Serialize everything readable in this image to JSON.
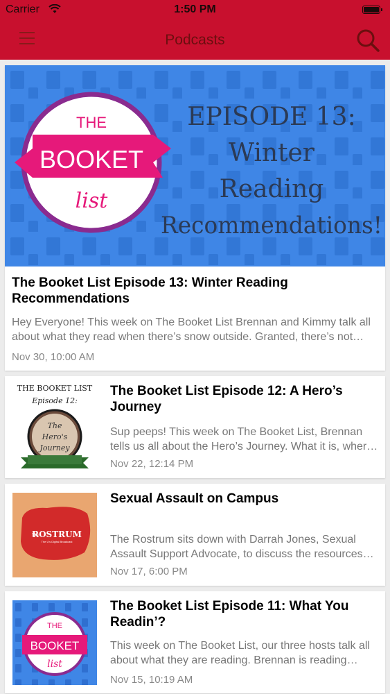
{
  "status_bar": {
    "carrier": "Carrier",
    "time": "1:50 PM"
  },
  "nav": {
    "title": "Podcasts",
    "menu_icon": "hamburger-menu-icon",
    "search_icon": "search-icon"
  },
  "feature": {
    "banner": {
      "brand_top": "THE",
      "brand_main": "BOOKET",
      "brand_bottom": "list",
      "line1": "EPISODE 13:",
      "line2": "Winter",
      "line3": "Reading",
      "line4": "Recommendations!"
    },
    "title": "The Booket List Episode 13: Winter Reading Recommendations",
    "description": "Hey Everyone! This week on The Booket List Brennan and Kimmy talk all about what they read when there’s snow outside. Granted, there’s not much snow outside yet, but we’re getting there!",
    "date": "Nov 30, 10:00 AM"
  },
  "episodes": [
    {
      "title": "The Booket List Episode 12: A Hero’s Journey",
      "description": "Sup peeps! This week on The Booket List, Brennan tells us all about the Hero’s Journey. What it is, where it comes from, and why it matters.",
      "date": "Nov 22, 12:14 PM",
      "thumb": {
        "header": "THE BOOKET LIST",
        "sub": "Episode 12:",
        "w1": "The",
        "w2": "Hero's",
        "w3": "Journey"
      }
    },
    {
      "title": "Sexual Assault on Campus",
      "description": "The Rostrum sits down with Darrah Jones, Sexual Assault Support Advocate, to discuss the resources available on campus.",
      "date": "Nov 17, 6:00 PM",
      "thumb": {
        "logo_small": "the",
        "logo": "ROSTRUM",
        "tagline": "The U's Digital Broadcast"
      }
    },
    {
      "title": "The Booket List Episode 11: What You Readin’?",
      "description": "This week on The Booket List, our three hosts talk all about what they are reading. Brennan is reading fantasy, Kimmy is reading memoirs.",
      "date": "Nov 15, 10:19 AM",
      "thumb": {
        "brand_top": "THE",
        "brand_main": "BOOKET",
        "brand_bottom": "list"
      }
    }
  ],
  "colors": {
    "brand_red": "#c8102e",
    "banner_blue": "#3f86e6",
    "ribbon_pink": "#e6197a"
  }
}
